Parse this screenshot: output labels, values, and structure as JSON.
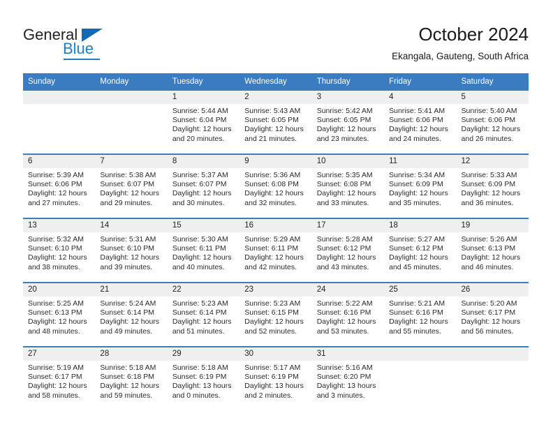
{
  "brand": {
    "word_one": "General",
    "word_two": "Blue",
    "triangle_icon": "triangle-right-icon",
    "accent_color": "#1f7fc4"
  },
  "header": {
    "month_title": "October 2024",
    "location": "Ekangala, Gauteng, South Africa"
  },
  "calendar": {
    "header_color": "#3a7cbf",
    "daynum_band_color": "#efefef",
    "weekdays": [
      "Sunday",
      "Monday",
      "Tuesday",
      "Wednesday",
      "Thursday",
      "Friday",
      "Saturday"
    ],
    "weeks": [
      [
        {
          "day": "",
          "empty": true
        },
        {
          "day": "",
          "empty": true
        },
        {
          "day": "1",
          "sunrise": "Sunrise: 5:44 AM",
          "sunset": "Sunset: 6:04 PM",
          "daylight": "Daylight: 12 hours and 20 minutes."
        },
        {
          "day": "2",
          "sunrise": "Sunrise: 5:43 AM",
          "sunset": "Sunset: 6:05 PM",
          "daylight": "Daylight: 12 hours and 21 minutes."
        },
        {
          "day": "3",
          "sunrise": "Sunrise: 5:42 AM",
          "sunset": "Sunset: 6:05 PM",
          "daylight": "Daylight: 12 hours and 23 minutes."
        },
        {
          "day": "4",
          "sunrise": "Sunrise: 5:41 AM",
          "sunset": "Sunset: 6:06 PM",
          "daylight": "Daylight: 12 hours and 24 minutes."
        },
        {
          "day": "5",
          "sunrise": "Sunrise: 5:40 AM",
          "sunset": "Sunset: 6:06 PM",
          "daylight": "Daylight: 12 hours and 26 minutes."
        }
      ],
      [
        {
          "day": "6",
          "sunrise": "Sunrise: 5:39 AM",
          "sunset": "Sunset: 6:06 PM",
          "daylight": "Daylight: 12 hours and 27 minutes."
        },
        {
          "day": "7",
          "sunrise": "Sunrise: 5:38 AM",
          "sunset": "Sunset: 6:07 PM",
          "daylight": "Daylight: 12 hours and 29 minutes."
        },
        {
          "day": "8",
          "sunrise": "Sunrise: 5:37 AM",
          "sunset": "Sunset: 6:07 PM",
          "daylight": "Daylight: 12 hours and 30 minutes."
        },
        {
          "day": "9",
          "sunrise": "Sunrise: 5:36 AM",
          "sunset": "Sunset: 6:08 PM",
          "daylight": "Daylight: 12 hours and 32 minutes."
        },
        {
          "day": "10",
          "sunrise": "Sunrise: 5:35 AM",
          "sunset": "Sunset: 6:08 PM",
          "daylight": "Daylight: 12 hours and 33 minutes."
        },
        {
          "day": "11",
          "sunrise": "Sunrise: 5:34 AM",
          "sunset": "Sunset: 6:09 PM",
          "daylight": "Daylight: 12 hours and 35 minutes."
        },
        {
          "day": "12",
          "sunrise": "Sunrise: 5:33 AM",
          "sunset": "Sunset: 6:09 PM",
          "daylight": "Daylight: 12 hours and 36 minutes."
        }
      ],
      [
        {
          "day": "13",
          "sunrise": "Sunrise: 5:32 AM",
          "sunset": "Sunset: 6:10 PM",
          "daylight": "Daylight: 12 hours and 38 minutes."
        },
        {
          "day": "14",
          "sunrise": "Sunrise: 5:31 AM",
          "sunset": "Sunset: 6:10 PM",
          "daylight": "Daylight: 12 hours and 39 minutes."
        },
        {
          "day": "15",
          "sunrise": "Sunrise: 5:30 AM",
          "sunset": "Sunset: 6:11 PM",
          "daylight": "Daylight: 12 hours and 40 minutes."
        },
        {
          "day": "16",
          "sunrise": "Sunrise: 5:29 AM",
          "sunset": "Sunset: 6:11 PM",
          "daylight": "Daylight: 12 hours and 42 minutes."
        },
        {
          "day": "17",
          "sunrise": "Sunrise: 5:28 AM",
          "sunset": "Sunset: 6:12 PM",
          "daylight": "Daylight: 12 hours and 43 minutes."
        },
        {
          "day": "18",
          "sunrise": "Sunrise: 5:27 AM",
          "sunset": "Sunset: 6:12 PM",
          "daylight": "Daylight: 12 hours and 45 minutes."
        },
        {
          "day": "19",
          "sunrise": "Sunrise: 5:26 AM",
          "sunset": "Sunset: 6:13 PM",
          "daylight": "Daylight: 12 hours and 46 minutes."
        }
      ],
      [
        {
          "day": "20",
          "sunrise": "Sunrise: 5:25 AM",
          "sunset": "Sunset: 6:13 PM",
          "daylight": "Daylight: 12 hours and 48 minutes."
        },
        {
          "day": "21",
          "sunrise": "Sunrise: 5:24 AM",
          "sunset": "Sunset: 6:14 PM",
          "daylight": "Daylight: 12 hours and 49 minutes."
        },
        {
          "day": "22",
          "sunrise": "Sunrise: 5:23 AM",
          "sunset": "Sunset: 6:14 PM",
          "daylight": "Daylight: 12 hours and 51 minutes."
        },
        {
          "day": "23",
          "sunrise": "Sunrise: 5:23 AM",
          "sunset": "Sunset: 6:15 PM",
          "daylight": "Daylight: 12 hours and 52 minutes."
        },
        {
          "day": "24",
          "sunrise": "Sunrise: 5:22 AM",
          "sunset": "Sunset: 6:16 PM",
          "daylight": "Daylight: 12 hours and 53 minutes."
        },
        {
          "day": "25",
          "sunrise": "Sunrise: 5:21 AM",
          "sunset": "Sunset: 6:16 PM",
          "daylight": "Daylight: 12 hours and 55 minutes."
        },
        {
          "day": "26",
          "sunrise": "Sunrise: 5:20 AM",
          "sunset": "Sunset: 6:17 PM",
          "daylight": "Daylight: 12 hours and 56 minutes."
        }
      ],
      [
        {
          "day": "27",
          "sunrise": "Sunrise: 5:19 AM",
          "sunset": "Sunset: 6:17 PM",
          "daylight": "Daylight: 12 hours and 58 minutes."
        },
        {
          "day": "28",
          "sunrise": "Sunrise: 5:18 AM",
          "sunset": "Sunset: 6:18 PM",
          "daylight": "Daylight: 12 hours and 59 minutes."
        },
        {
          "day": "29",
          "sunrise": "Sunrise: 5:18 AM",
          "sunset": "Sunset: 6:19 PM",
          "daylight": "Daylight: 13 hours and 0 minutes."
        },
        {
          "day": "30",
          "sunrise": "Sunrise: 5:17 AM",
          "sunset": "Sunset: 6:19 PM",
          "daylight": "Daylight: 13 hours and 2 minutes."
        },
        {
          "day": "31",
          "sunrise": "Sunrise: 5:16 AM",
          "sunset": "Sunset: 6:20 PM",
          "daylight": "Daylight: 13 hours and 3 minutes."
        },
        {
          "day": "",
          "empty": true
        },
        {
          "day": "",
          "empty": true
        }
      ]
    ]
  }
}
